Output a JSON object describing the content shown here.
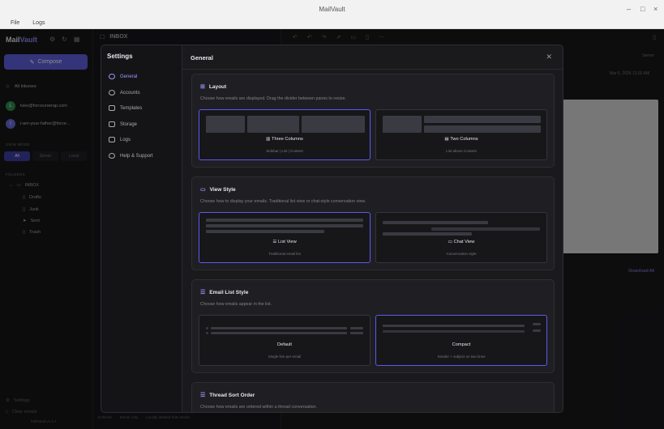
{
  "window": {
    "title": "MailVault",
    "controls": [
      "–",
      "□",
      "×"
    ]
  },
  "menu": [
    "File",
    "Logs"
  ],
  "sidebar": {
    "logo_a": "Mail",
    "logo_b": "Vault",
    "compose_label": "Compose",
    "all_inboxes": "All Inboxes",
    "accounts": [
      {
        "initial": "L",
        "email": "luke@forceunwrap.com",
        "color": "#2f8f4f"
      },
      {
        "initial": "I",
        "email": "i-am-your-father@force...",
        "color": "#6b6bd8"
      }
    ],
    "view_mode_label": "VIEW MODE",
    "view_modes": [
      "All",
      "Server",
      "Local"
    ],
    "folders_label": "FOLDERS",
    "folders": [
      "INBOX",
      "Drafts",
      "Junk",
      "Sent",
      "Trash"
    ],
    "settings_label": "Settings",
    "clear_label": "Clear emails",
    "version": "MailVault v1.1.4"
  },
  "middle": {
    "folder_title": "INBOX"
  },
  "right": {
    "date": "Mar 5, 2026 12:02 AM",
    "server_label": "Server",
    "download_all": "Download All"
  },
  "status": [
    "Archived",
    "Server only",
    "Locally deleted from server"
  ],
  "settings": {
    "title": "Settings",
    "nav": [
      "General",
      "Accounts",
      "Templates",
      "Storage",
      "Logs",
      "Help & Support"
    ],
    "active_nav": 0,
    "page_title": "General",
    "layout": {
      "title": "Layout",
      "desc": "Choose how emails are displayed. Drag the divider between panes to resize.",
      "options": [
        {
          "label": "Three Columns",
          "sub": "Sidebar | List | Content",
          "selected": true
        },
        {
          "label": "Two Columns",
          "sub": "List above Content",
          "selected": false
        }
      ]
    },
    "view_style": {
      "title": "View Style",
      "desc": "Choose how to display your emails. Traditional list view or chat-style conversation view.",
      "options": [
        {
          "label": "List View",
          "sub": "Traditional email list",
          "selected": true
        },
        {
          "label": "Chat View",
          "sub": "Conversation style",
          "selected": false
        }
      ]
    },
    "list_style": {
      "title": "Email List Style",
      "desc": "Choose how emails appear in the list.",
      "options": [
        {
          "label": "Default",
          "sub": "Single line per email",
          "selected": false
        },
        {
          "label": "Compact",
          "sub": "Sender + subject on two lines",
          "selected": true
        }
      ]
    },
    "thread_sort": {
      "title": "Thread Sort Order",
      "desc": "Choose how emails are ordered within a thread conversation."
    }
  }
}
